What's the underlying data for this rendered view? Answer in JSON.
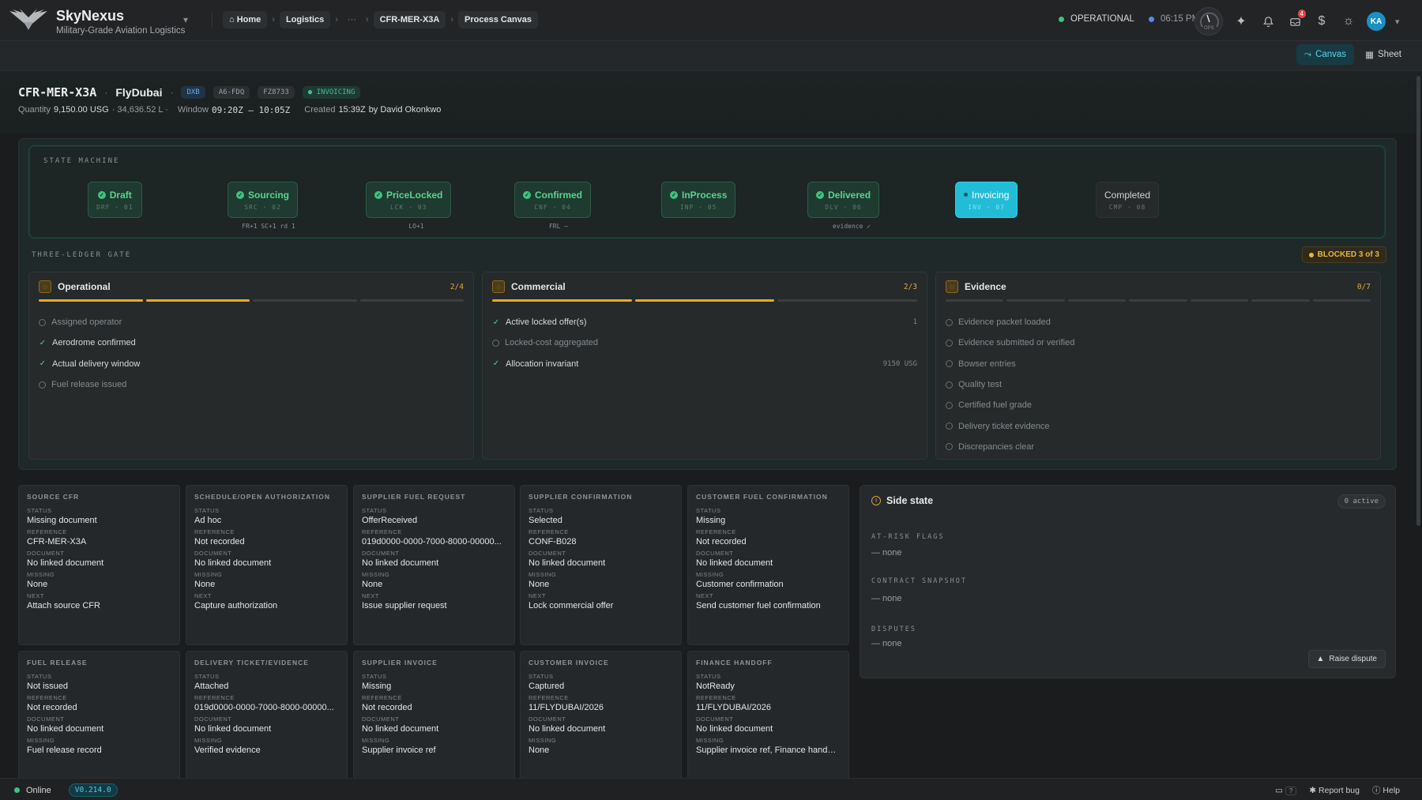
{
  "app": {
    "name": "SkyNexus",
    "tagline": "Military-Grade Aviation Logistics"
  },
  "breadcrumbs": [
    "Home",
    "Logistics",
    "···",
    "CFR-MER-X3A",
    "Process Canvas"
  ],
  "system": {
    "status": "OPERATIONAL",
    "time": "06:15 PM",
    "gauge_label": "OPS",
    "notif_count": "4",
    "avatar_initials": "KA"
  },
  "views": {
    "canvas": "Canvas",
    "sheet": "Sheet"
  },
  "header": {
    "id": "CFR-MER-X3A",
    "customer": "FlyDubai",
    "tags": [
      "DXB",
      "A6-FDQ",
      "FZ8733"
    ],
    "state_tag": "INVOICING",
    "quantity_label": "Quantity",
    "quantity_usg": "9,150.00 USG",
    "quantity_l": "· 34,636.52 L ·",
    "window_label": "Window",
    "window_value": "09:20Z – 10:05Z",
    "created_label": "Created",
    "created_value": "15:39Z",
    "created_by": "by David Okonkwo"
  },
  "state_machine": {
    "label": "STATE MACHINE",
    "nodes": [
      {
        "name": "Draft",
        "code": "DRF · 01",
        "status": "done"
      },
      {
        "name": "Sourcing",
        "code": "SRC · 02",
        "status": "done",
        "sub": "FR+1 SC+1 rd 1"
      },
      {
        "name": "PriceLocked",
        "code": "LCK · 03",
        "status": "done",
        "sub": "LO+1"
      },
      {
        "name": "Confirmed",
        "code": "CNF · 04",
        "status": "done",
        "sub": "FRL –"
      },
      {
        "name": "InProcess",
        "code": "INP · 05",
        "status": "done"
      },
      {
        "name": "Delivered",
        "code": "DLV · 06",
        "status": "done",
        "sub": "evidence ✓"
      },
      {
        "name": "Invoicing",
        "code": "INV · 07",
        "status": "current"
      },
      {
        "name": "Completed",
        "code": "CMP · 08",
        "status": "pending"
      }
    ]
  },
  "gate": {
    "label": "THREE-LEDGER GATE",
    "blocked": "BLOCKED 3 of 3",
    "ledgers": [
      {
        "title": "Operational",
        "count": "2/4",
        "progress": [
          1,
          1,
          0,
          0
        ],
        "items": [
          {
            "text": "Assigned operator",
            "done": false,
            "value": ""
          },
          {
            "text": "Aerodrome confirmed",
            "done": true,
            "value": ""
          },
          {
            "text": "Actual delivery window",
            "done": true,
            "value": ""
          },
          {
            "text": "Fuel release issued",
            "done": false,
            "value": ""
          }
        ]
      },
      {
        "title": "Commercial",
        "count": "2/3",
        "progress": [
          1,
          1,
          0
        ],
        "items": [
          {
            "text": "Active locked offer(s)",
            "done": true,
            "value": "1"
          },
          {
            "text": "Locked-cost aggregated",
            "done": false,
            "value": ""
          },
          {
            "text": "Allocation invariant",
            "done": true,
            "value": "9150 USG"
          }
        ]
      },
      {
        "title": "Evidence",
        "count": "0/7",
        "progress": [
          0,
          0,
          0,
          0,
          0,
          0,
          0
        ],
        "items": [
          {
            "text": "Evidence packet loaded",
            "done": false,
            "value": ""
          },
          {
            "text": "Evidence submitted or verified",
            "done": false,
            "value": ""
          },
          {
            "text": "Bowser entries",
            "done": false,
            "value": ""
          },
          {
            "text": "Quality test",
            "done": false,
            "value": ""
          },
          {
            "text": "Certified fuel grade",
            "done": false,
            "value": ""
          },
          {
            "text": "Delivery ticket evidence",
            "done": false,
            "value": ""
          },
          {
            "text": "Discrepancies clear",
            "done": false,
            "value": ""
          }
        ]
      }
    ]
  },
  "field_labels": {
    "status": "STATUS",
    "reference": "REFERENCE",
    "document": "DOCUMENT",
    "missing": "MISSING",
    "next": "NEXT"
  },
  "cards": [
    {
      "title": "SOURCE CFR",
      "status": "Missing document",
      "reference": "CFR-MER-X3A",
      "document": "No linked document",
      "missing": "None",
      "next": "Attach source CFR"
    },
    {
      "title": "SCHEDULE/OPEN AUTHORIZATION",
      "status": "Ad hoc",
      "reference": "Not recorded",
      "document": "No linked document",
      "missing": "None",
      "next": "Capture authorization"
    },
    {
      "title": "SUPPLIER FUEL REQUEST",
      "status": "OfferReceived",
      "reference": "019d0000-0000-7000-8000-00000...",
      "document": "No linked document",
      "missing": "None",
      "next": "Issue supplier request"
    },
    {
      "title": "SUPPLIER CONFIRMATION",
      "status": "Selected",
      "reference": "CONF-B028",
      "document": "No linked document",
      "missing": "None",
      "next": "Lock commercial offer"
    },
    {
      "title": "CUSTOMER FUEL CONFIRMATION",
      "status": "Missing",
      "reference": "Not recorded",
      "document": "No linked document",
      "missing": "Customer confirmation",
      "next": "Send customer fuel confirmation"
    },
    {
      "title": "FUEL RELEASE",
      "status": "Not issued",
      "reference": "Not recorded",
      "document": "No linked document",
      "missing": "Fuel release record",
      "next": ""
    },
    {
      "title": "DELIVERY TICKET/EVIDENCE",
      "status": "Attached",
      "reference": "019d0000-0000-7000-8000-00000...",
      "document": "No linked document",
      "missing": "Verified evidence",
      "next": ""
    },
    {
      "title": "SUPPLIER INVOICE",
      "status": "Missing",
      "reference": "Not recorded",
      "document": "No linked document",
      "missing": "Supplier invoice ref",
      "next": ""
    },
    {
      "title": "CUSTOMER INVOICE",
      "status": "Captured",
      "reference": "11/FLYDUBAI/2026",
      "document": "No linked document",
      "missing": "None",
      "next": ""
    },
    {
      "title": "FINANCE HANDOFF",
      "status": "NotReady",
      "reference": "11/FLYDUBAI/2026",
      "document": "No linked document",
      "missing": "Supplier invoice ref, Finance handof...",
      "next": ""
    }
  ],
  "side_state": {
    "title": "Side state",
    "active": "0 active",
    "at_risk_label": "AT-RISK FLAGS",
    "at_risk_value": "— none",
    "contract_label": "CONTRACT SNAPSHOT",
    "contract_value": "— none",
    "disputes_label": "DISPUTES",
    "disputes_value": "— none",
    "raise_dispute": "Raise dispute"
  },
  "footer": {
    "online": "Online",
    "version": "V0.214.0",
    "kbd": "?",
    "report_bug": "Report bug",
    "help": "Help"
  },
  "colors": {
    "accent": "#22bcd6",
    "done": "#58d48f",
    "warning": "#e6a92c",
    "online": "#3fc27d"
  }
}
